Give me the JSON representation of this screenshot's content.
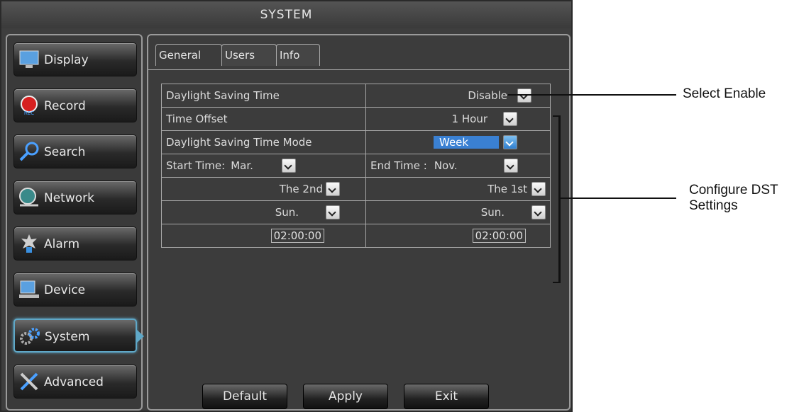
{
  "window": {
    "title": "SYSTEM"
  },
  "sidebar": {
    "items": [
      {
        "label": "Display"
      },
      {
        "label": "Record"
      },
      {
        "label": "Search"
      },
      {
        "label": "Network"
      },
      {
        "label": "Alarm"
      },
      {
        "label": "Device"
      },
      {
        "label": "System"
      },
      {
        "label": "Advanced"
      }
    ],
    "active": "System",
    "record_icon_text": "REC"
  },
  "tabs": [
    {
      "label": "General"
    },
    {
      "label": "Users"
    },
    {
      "label": "Info"
    }
  ],
  "settings": {
    "dst_label": "Daylight Saving Time",
    "dst_value": "Disable",
    "offset_label": "Time Offset",
    "offset_value": "1 Hour",
    "mode_label": "Daylight Saving Time Mode",
    "mode_value": "Week",
    "start_label": "Start Time:",
    "start_month": "Mar.",
    "end_label": "End Time :",
    "end_month": "Nov.",
    "start_week": "The 2nd",
    "end_week": "The 1st",
    "start_day": "Sun.",
    "end_day": "Sun.",
    "start_time": "02:00:00",
    "end_time": "02:00:00"
  },
  "buttons": {
    "default": "Default",
    "apply": "Apply",
    "exit": "Exit"
  },
  "callouts": {
    "select_enable": "Select Enable",
    "configure_line1": "Configure DST",
    "configure_line2": "Settings"
  },
  "colors": {
    "accent": "#5fa8c8",
    "highlight": "#3a80d2",
    "panel": "#3c3c3c"
  }
}
